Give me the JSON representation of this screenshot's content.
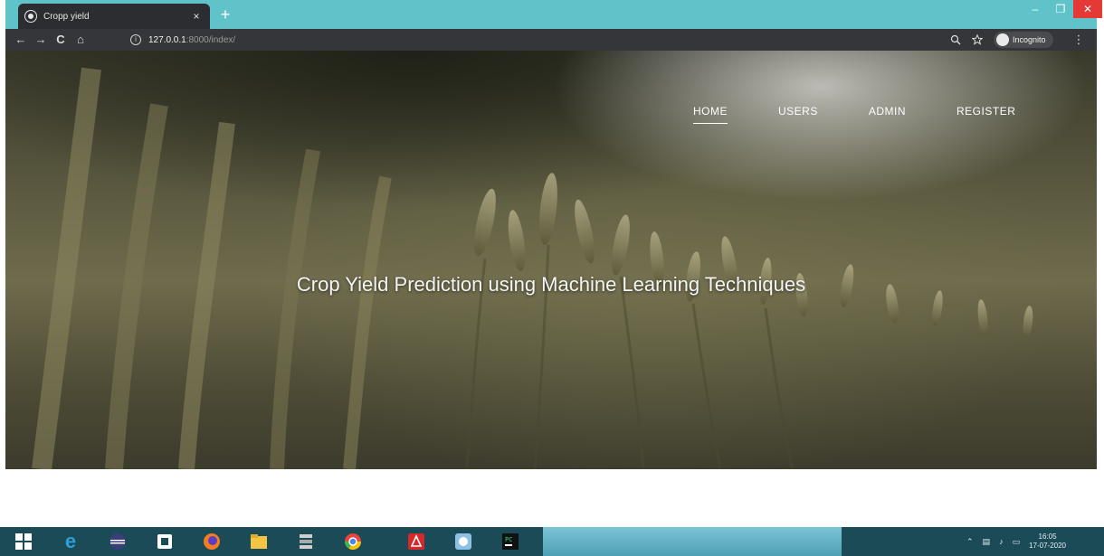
{
  "browser": {
    "tab_title": "Cropp yield",
    "tab_close": "×",
    "new_tab": "+",
    "window_controls": {
      "minimize": "–",
      "maximize": "❐",
      "close": "✕"
    },
    "toolbar": {
      "back": "←",
      "forward": "→",
      "reload": "C",
      "home": "⌂",
      "url_host": "127.0.0.1",
      "url_path": ":8000/index/",
      "zoom_icon": "zoom-icon",
      "star_icon": "star-icon",
      "incognito_label": "Incognito",
      "menu": "⋮"
    }
  },
  "hero": {
    "nav": [
      {
        "label": "HOME",
        "active": true
      },
      {
        "label": "USERS",
        "active": false
      },
      {
        "label": "ADMIN",
        "active": false
      },
      {
        "label": "REGISTER",
        "active": false
      }
    ],
    "title": "Crop Yield Prediction using Machine Learning Techniques"
  },
  "taskbar": {
    "apps": [
      {
        "name": "start-icon",
        "color": "#ffffff"
      },
      {
        "name": "internet-explorer-icon",
        "color": "#2d9fd9"
      },
      {
        "name": "eclipse-icon",
        "color": "#3a3e7a"
      },
      {
        "name": "office-icon",
        "color": "#ffffff"
      },
      {
        "name": "firefox-icon",
        "color": "#f57c1f"
      },
      {
        "name": "file-explorer-icon",
        "color": "#f4c542"
      },
      {
        "name": "database-icon",
        "color": "#cfcfcf"
      },
      {
        "name": "chrome-icon",
        "color": "#e8453c"
      },
      {
        "name": "acrobat-icon",
        "color": "#d6272a"
      },
      {
        "name": "app-icon",
        "color": "#8fc1e6"
      },
      {
        "name": "pycharm-icon",
        "color": "#111111"
      }
    ],
    "clock_time": "16:05",
    "clock_date": "17-07-2020"
  }
}
